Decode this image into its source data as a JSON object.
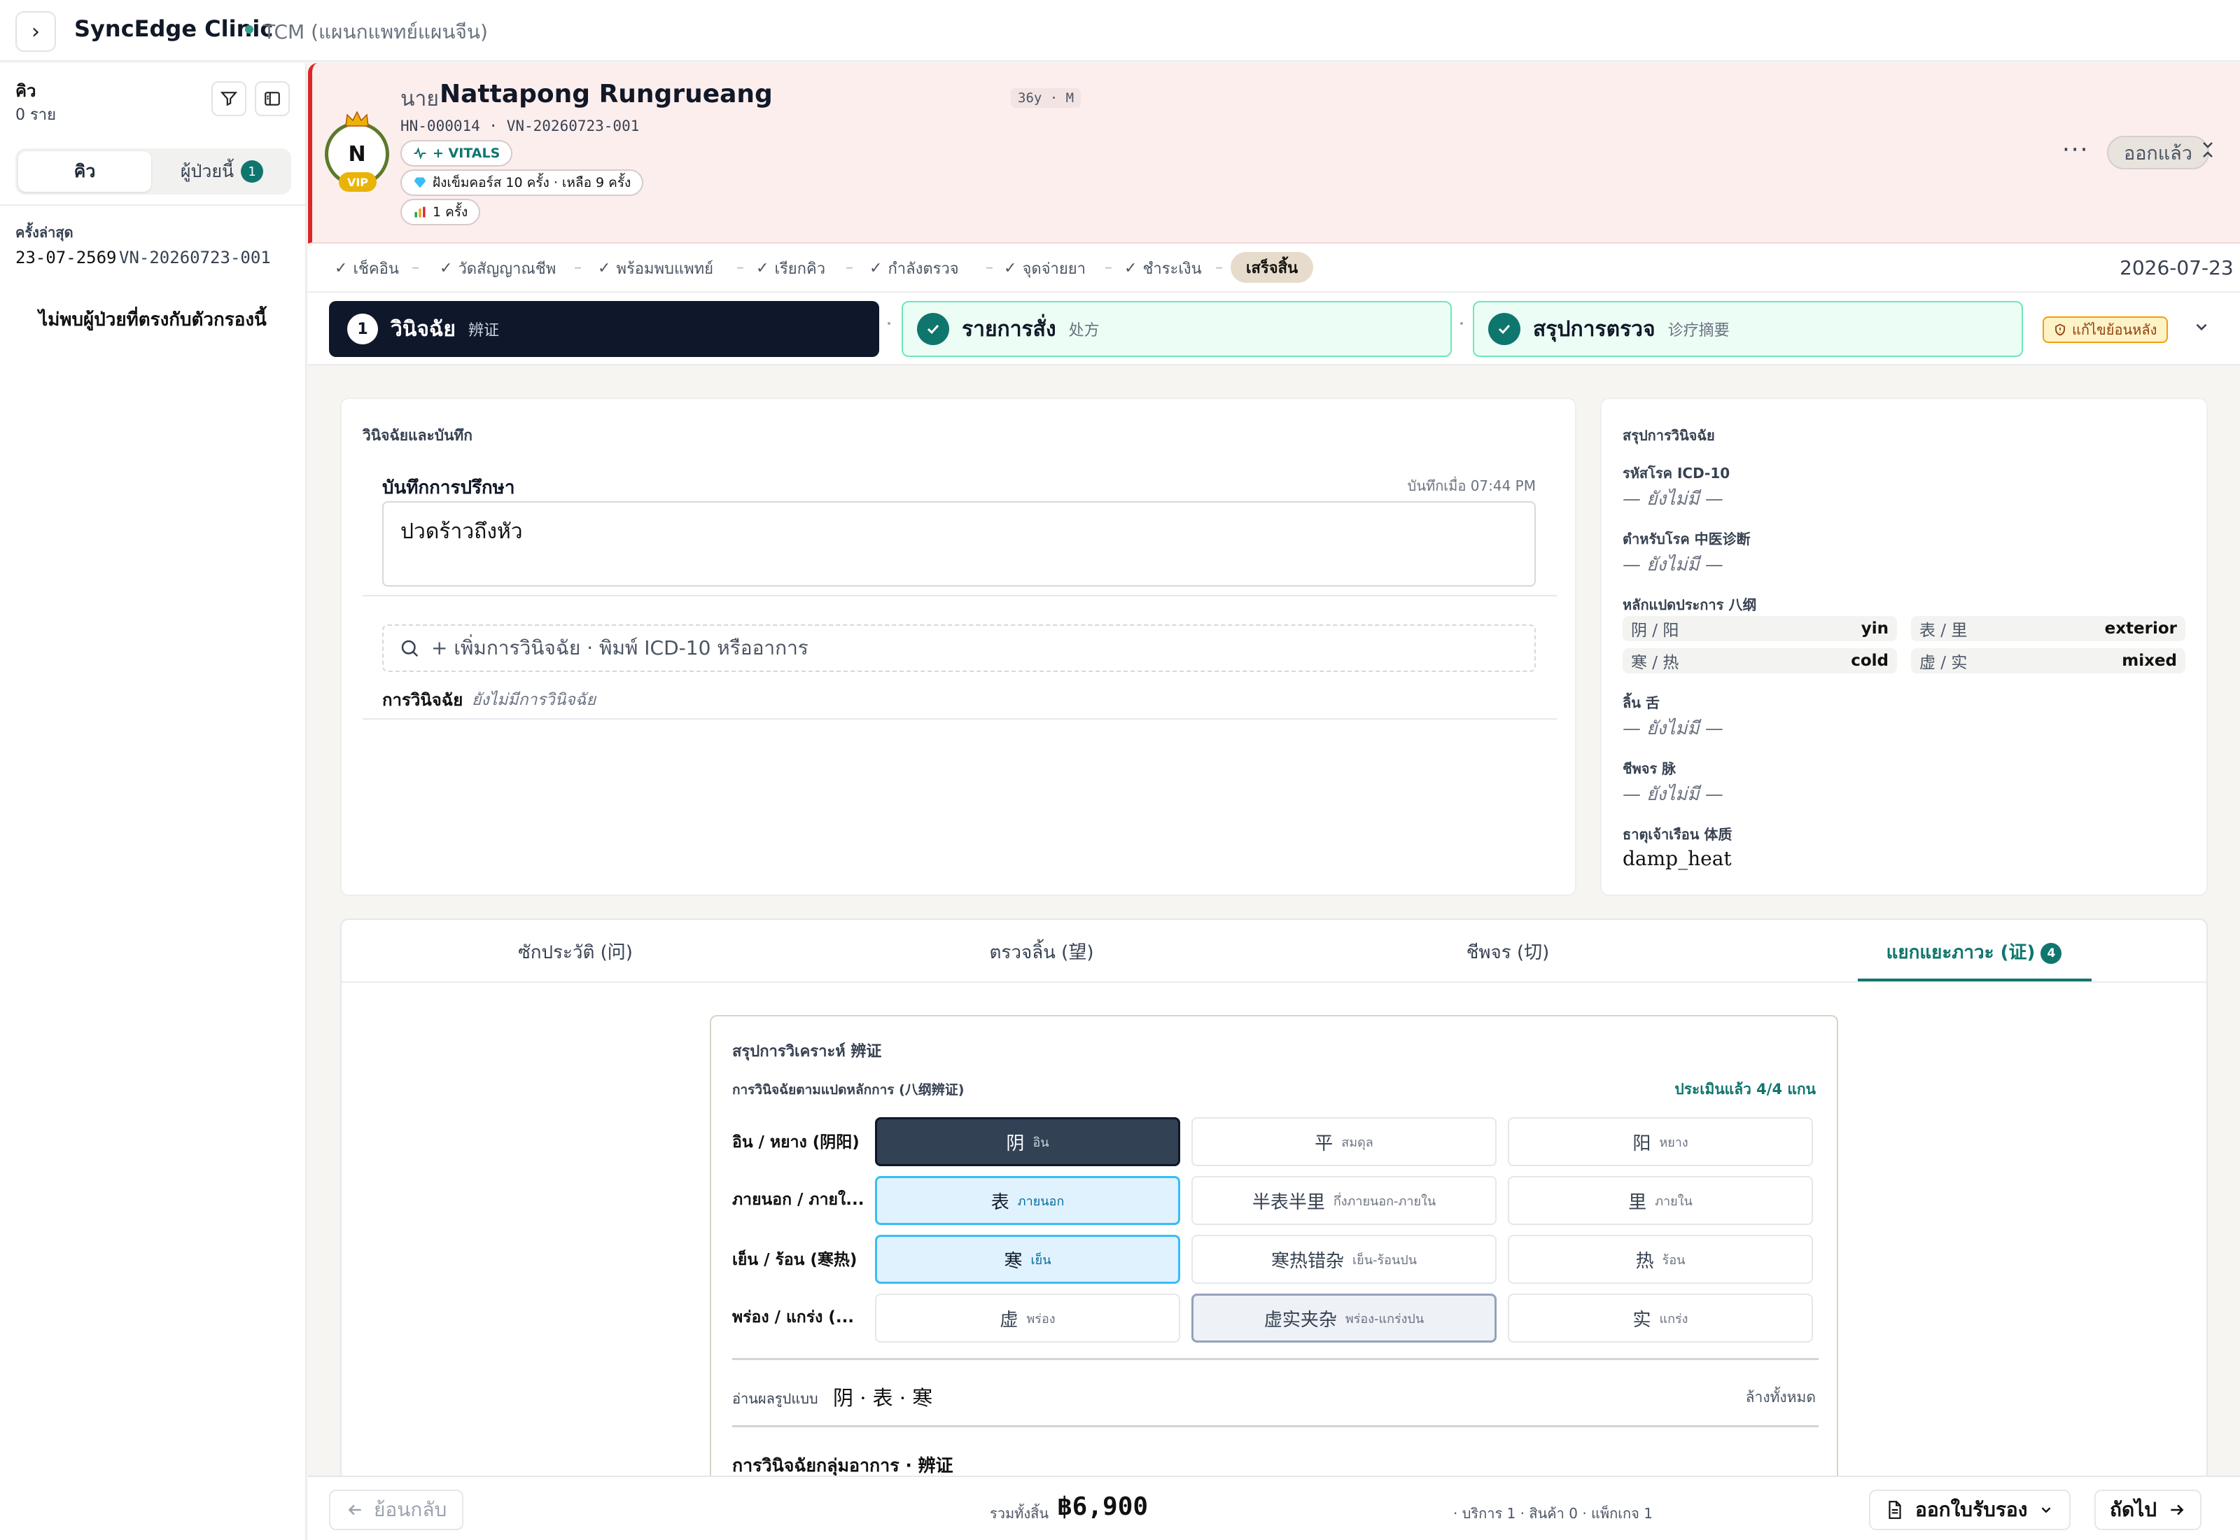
{
  "topbar": {
    "clinic": "SyncEdge Clinic",
    "department": "TCM (แผนกแพทย์แผนจีน)"
  },
  "sidebar": {
    "title": "คิว",
    "count": "0 ราย",
    "tab_queue": "คิว",
    "tab_patients": "ผู้ป่วยนี้",
    "tab_patients_badge": "1",
    "last_visit_label": "ครั้งล่าสุด",
    "last_visit_date": "23-07-2569",
    "last_visit_vn": "VN-20260723-001",
    "empty": "ไม่พบผู้ป่วยที่ตรงกับตัวกรองนี้"
  },
  "patient": {
    "initial": "N",
    "vip": "VIP",
    "title": "นาย",
    "name": "Nattapong Rungrueang",
    "meta": "36y · M",
    "hn_line": "HN-000014 · VN-20260723-001",
    "vitals_chip": "+ VITALS",
    "course_chip": "ฝังเข็มคอร์ส 10 ครั้ง · เหลือ 9 ครั้ง",
    "visits_chip": "1 ครั้ง",
    "more": "···",
    "status_pill": "ออกแล้ว"
  },
  "steps": [
    {
      "label": "เช็คอิน"
    },
    {
      "label": "วัดสัญญาณชีพ"
    },
    {
      "label": "พร้อมพบแพทย์"
    },
    {
      "label": "เรียกคิว"
    },
    {
      "label": "กำลังตรวจ"
    },
    {
      "label": "จุดจ่ายยา"
    },
    {
      "label": "ชำระเงิน"
    }
  ],
  "step_done": "เสร็จสิ้น",
  "visit_date": "2026-07-23",
  "stages": {
    "s1_num": "1",
    "s1_title": "วินิจฉัย",
    "s1_sub": "辨证",
    "s2_title": "รายการสั่ง",
    "s2_sub": "处方",
    "s3_title": "สรุปการตรวจ",
    "s3_sub": "诊疗摘要",
    "amend": "แก้ไขย้อนหลัง"
  },
  "diagnosis_card": {
    "heading": "วินิจฉัยและบันทึก",
    "notes_label": "บันทึกการปรึกษา",
    "saved": "บันทึกเมื่อ 07:44 PM",
    "notes_value": "ปวดร้าวถึงหัว",
    "add_placeholder": "+ เพิ่มการวินิจฉัย · พิมพ์ ICD-10 หรืออาการ",
    "dx_label": "การวินิจฉัย",
    "dx_none": "ยังไม่มีการวินิจฉัย"
  },
  "summary_card": {
    "heading": "สรุปการวินิจฉัย",
    "icd_label": "รหัสโรค ICD-10",
    "icd_value": "— ยังไม่มี —",
    "tcm_label": "ตำหรับโรค 中医诊断",
    "tcm_value": "— ยังไม่มี —",
    "bagang_label": "หลักแปดประการ 八纲",
    "pairs": [
      {
        "k": "阴 / 阳",
        "v": "yin"
      },
      {
        "k": "表 / 里",
        "v": "exterior"
      },
      {
        "k": "寒 / 热",
        "v": "cold"
      },
      {
        "k": "虚 / 实",
        "v": "mixed"
      }
    ],
    "tongue_label": "ลิ้น 舌",
    "tongue_value": "— ยังไม่มี —",
    "pulse_label": "ชีพจร 脉",
    "pulse_value": "— ยังไม่มี —",
    "constitution_label": "ธาตุเจ้าเรือน 体质",
    "constitution_value": "damp_heat"
  },
  "tabs": [
    {
      "label": "ซักประวัติ (问)"
    },
    {
      "label": "ตรวจลิ้น (望)"
    },
    {
      "label": "ชีพจร (切)"
    },
    {
      "label": "แยกแยะภาวะ (证)",
      "badge": "4"
    }
  ],
  "analysis": {
    "title": "สรุปการวิเคราะห์ 辨证",
    "subtitle": "การวินิจฉัยตามแปดหลักการ (八纲辨证)",
    "evaluated": "ประเมินแล้ว 4/4 แกน",
    "rows": [
      {
        "label": "อิน / หยาง (阴阳)",
        "options": [
          {
            "h": "阴",
            "t": "อิน"
          },
          {
            "h": "平",
            "t": "สมดุล"
          },
          {
            "h": "阳",
            "t": "หยาง"
          }
        ]
      },
      {
        "label": "ภายนอก / ภายใ...",
        "options": [
          {
            "h": "表",
            "t": "ภายนอก"
          },
          {
            "h": "半表半里",
            "t": "กึ่งภายนอก-ภายใน"
          },
          {
            "h": "里",
            "t": "ภายใน"
          }
        ]
      },
      {
        "label": "เย็น / ร้อน (寒热)",
        "options": [
          {
            "h": "寒",
            "t": "เย็น"
          },
          {
            "h": "寒热错杂",
            "t": "เย็น-ร้อนปน"
          },
          {
            "h": "热",
            "t": "ร้อน"
          }
        ]
      },
      {
        "label": "พร่อง / แกร่ง (...",
        "options": [
          {
            "h": "虚",
            "t": "พร่อง"
          },
          {
            "h": "虚实夹杂",
            "t": "พร่อง-แกร่งปน"
          },
          {
            "h": "实",
            "t": "แกร่ง"
          }
        ]
      }
    ],
    "reading_label": "อ่านผลรูปแบบ",
    "reading_value": "阴 · 表 · 寒",
    "clear": "ล้างทั้งหมด",
    "group_dx": "การวินิจฉัยกลุ่มอาการ · 辨证"
  },
  "footer": {
    "back": "ย้อนกลับ",
    "total_label": "รวมทั้งสิ้น",
    "total": "฿6,900",
    "detail": "· บริการ 1 · สินค้า 0 · แพ็กเกจ 1",
    "certificate": "ออกใบรับรอง",
    "next": "ถัดไป"
  },
  "colors": {
    "accent": "#0f766e",
    "alert": "#dc2626",
    "vip": "#eab308",
    "dark": "#0f172a"
  }
}
